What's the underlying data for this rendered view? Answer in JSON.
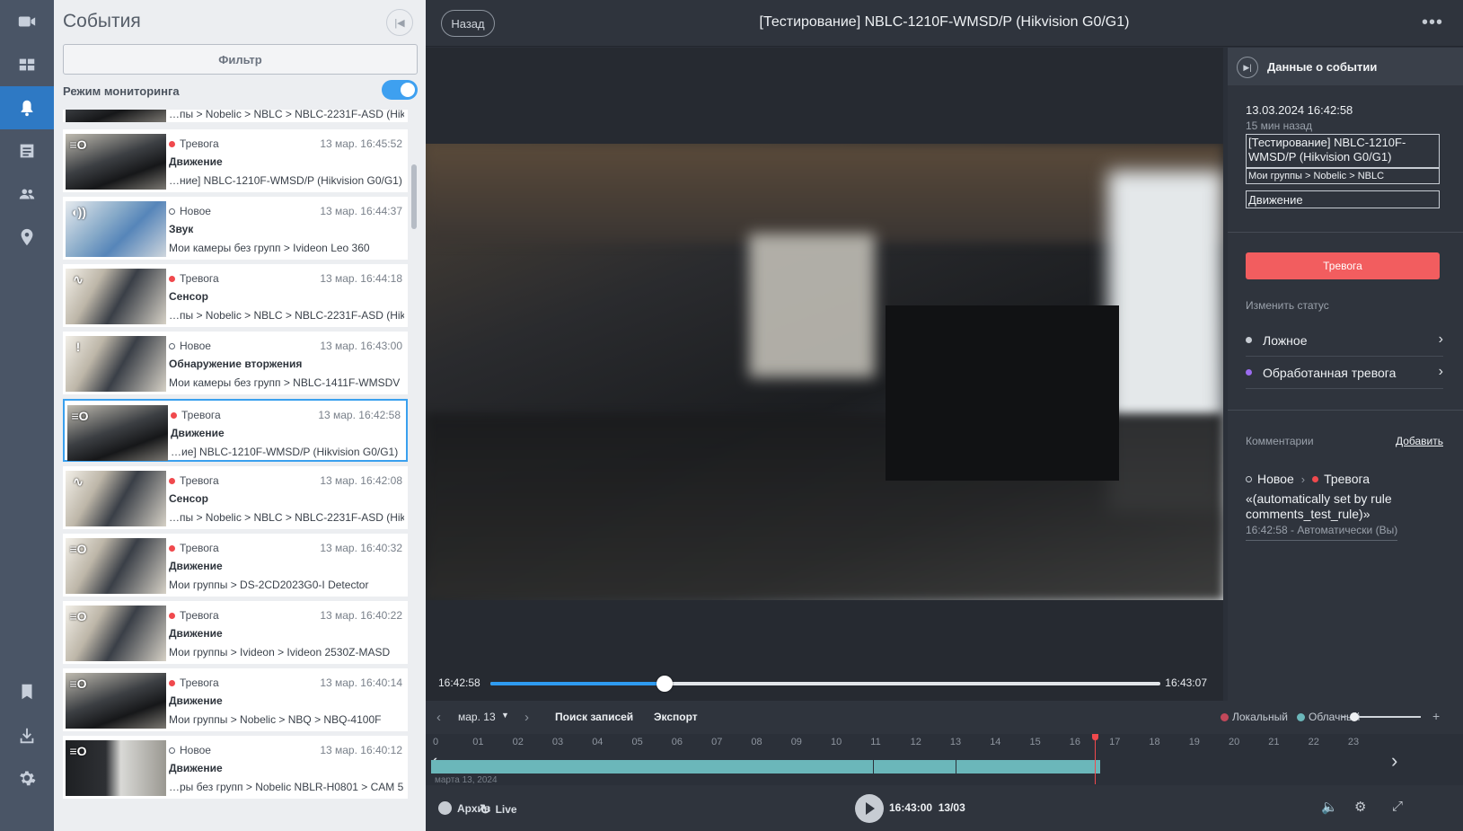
{
  "rail": {
    "items": [
      {
        "icon": "video-camera-icon",
        "active": false
      },
      {
        "icon": "dashboard-grid-icon",
        "active": false
      },
      {
        "icon": "bell-icon",
        "active": true
      },
      {
        "icon": "list-document-icon",
        "active": false
      },
      {
        "icon": "users-icon",
        "active": false
      },
      {
        "icon": "map-pin-icon",
        "active": false
      },
      {
        "icon": "bookmark-icon",
        "active": false
      },
      {
        "icon": "download-icon",
        "active": false
      },
      {
        "icon": "settings-gear-icon",
        "active": false
      }
    ]
  },
  "events_panel": {
    "title": "События",
    "filter_label": "Фильтр",
    "monitoring_label": "Режим мониторинга",
    "monitoring_on": true,
    "partial_top": {
      "path": "…пы > Nobelic > NBLC > NBLC-2231F-ASD (Hik)"
    },
    "events": [
      {
        "status": "Тревога",
        "status_kind": "alarm",
        "time": "13 мар. 16:45:52",
        "type": "Движение",
        "path": "…ние] NBLC-1210F-WMSD/P (Hikvision G0/G1)",
        "icon": "motion-icon",
        "icon_glyph": "≡O",
        "thumb": "dark",
        "selected": false
      },
      {
        "status": "Новое",
        "status_kind": "new",
        "time": "13 мар. 16:44:37",
        "type": "Звук",
        "path": "Мои камеры без групп > Ivideon Leo 360",
        "icon": "sound-icon",
        "icon_glyph": "◖))",
        "thumb": "blue",
        "selected": false
      },
      {
        "status": "Тревога",
        "status_kind": "alarm",
        "time": "13 мар. 16:44:18",
        "type": "Сенсор",
        "path": "…пы > Nobelic > NBLC > NBLC-2231F-ASD (Hik)",
        "icon": "sensor-icon",
        "icon_glyph": "∿",
        "thumb": "office",
        "selected": false
      },
      {
        "status": "Новое",
        "status_kind": "new",
        "time": "13 мар. 16:43:00",
        "type": "Обнаружение вторжения",
        "path": "Мои камеры без групп > NBLC-1411F-WMSDV",
        "icon": "intrusion-icon",
        "icon_glyph": "!",
        "thumb": "office",
        "selected": false
      },
      {
        "status": "Тревога",
        "status_kind": "alarm",
        "time": "13 мар. 16:42:58",
        "type": "Движение",
        "path": "…ие] NBLC-1210F-WMSD/P (Hikvision G0/G1)",
        "icon": "motion-icon",
        "icon_glyph": "≡O",
        "thumb": "dark",
        "selected": true
      },
      {
        "status": "Тревога",
        "status_kind": "alarm",
        "time": "13 мар. 16:42:08",
        "type": "Сенсор",
        "path": "…пы > Nobelic > NBLC > NBLC-2231F-ASD (Hik)",
        "icon": "sensor-icon",
        "icon_glyph": "∿",
        "thumb": "office",
        "selected": false
      },
      {
        "status": "Тревога",
        "status_kind": "alarm",
        "time": "13 мар. 16:40:32",
        "type": "Движение",
        "path": "Мои группы > DS-2CD2023G0-I Detector",
        "icon": "motion-icon",
        "icon_glyph": "≡O",
        "thumb": "office",
        "selected": false
      },
      {
        "status": "Тревога",
        "status_kind": "alarm",
        "time": "13 мар. 16:40:22",
        "type": "Движение",
        "path": "Мои группы > Ivideon > Ivideon 2530Z-MASD",
        "icon": "motion-icon",
        "icon_glyph": "≡O",
        "thumb": "office",
        "selected": false
      },
      {
        "status": "Тревога",
        "status_kind": "alarm",
        "time": "13 мар. 16:40:14",
        "type": "Движение",
        "path": "Мои группы > Nobelic > NBQ > NBQ-4100F",
        "icon": "motion-icon",
        "icon_glyph": "≡O",
        "thumb": "dark",
        "selected": false
      },
      {
        "status": "Новое",
        "status_kind": "new",
        "time": "13 мар. 16:40:12",
        "type": "Движение",
        "path": "…ры без групп > Nobelic NBLR-H0801 > CAM 5",
        "icon": "motion-icon",
        "icon_glyph": "≡O",
        "thumb": "door",
        "selected": false
      }
    ]
  },
  "header": {
    "back_label": "Назад",
    "camera_title": "[Тестирование] NBLC-1210F-WMSD/P (Hikvision G0/G1)",
    "more_glyph": "•••"
  },
  "player": {
    "start_time": "16:42:58",
    "end_time": "16:43:07",
    "progress": 0.26
  },
  "details": {
    "title": "Данные о событии",
    "datetime": "13.03.2024 16:42:58",
    "ago": "15 мин назад",
    "camera": "[Тестирование] NBLC-1210F-WMSD/P (Hikvision G0/G1)",
    "group": "Мои группы > Nobelic > NBLC",
    "event_type": "Движение",
    "alarm_button": "Тревога",
    "change_status_label": "Изменить статус",
    "status_options": [
      {
        "label": "Ложное",
        "color": "#c7ccd3"
      },
      {
        "label": "Обработанная тревога",
        "color": "#9b6cf0"
      }
    ],
    "comments_label": "Комментарии",
    "add_label": "Добавить",
    "history": {
      "from": "Новое",
      "to": "Тревога",
      "text": "«(automatically set by rule comments_test_rule)»",
      "meta": "16:42:58 - Автоматически (Вы)"
    }
  },
  "timeline": {
    "date_label": "мар. 13",
    "search_label": "Поиск записей",
    "export_label": "Экспорт",
    "legend_local": "Локальный",
    "legend_cloud": "Облачный",
    "legend_local_color": "#c2485a",
    "legend_cloud_color": "#6bb7ba",
    "zoom_minus": "−",
    "zoom_plus": "+",
    "hours": [
      "0",
      "01",
      "02",
      "03",
      "04",
      "05",
      "06",
      "07",
      "08",
      "09",
      "10",
      "11",
      "12",
      "13",
      "14",
      "15",
      "16",
      "17",
      "18",
      "19",
      "20",
      "21",
      "22",
      "23"
    ],
    "sub_label": "марта 13, 2024",
    "cursor_hour": 16.72
  },
  "bottom_bar": {
    "archive_label": "Архив",
    "live_label": "Live",
    "current_time": "16:43:00",
    "current_date": "13/03"
  }
}
